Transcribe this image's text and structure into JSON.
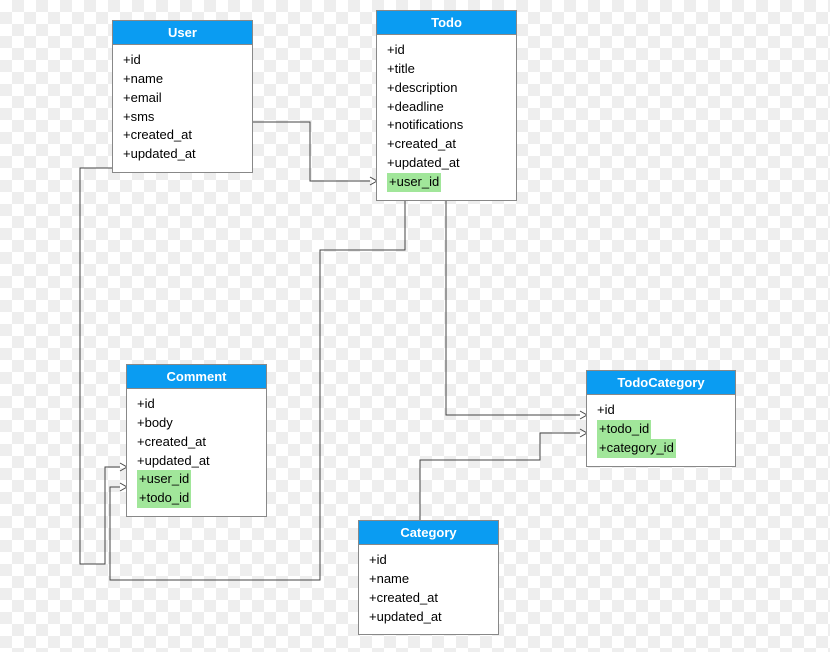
{
  "entities": {
    "user": {
      "title": "User",
      "attrs": [
        "+id",
        "+name",
        "+email",
        "+sms",
        "+created_at",
        "+updated_at"
      ],
      "fks": []
    },
    "todo": {
      "title": "Todo",
      "attrs": [
        "+id",
        "+title",
        "+description",
        "+deadline",
        "+notifications",
        "+created_at",
        "+updated_at"
      ],
      "fks": [
        "+user_id"
      ]
    },
    "comment": {
      "title": "Comment",
      "attrs": [
        "+id",
        "+body",
        "+created_at",
        "+updated_at"
      ],
      "fks": [
        "+user_id",
        "+todo_id"
      ]
    },
    "category": {
      "title": "Category",
      "attrs": [
        "+id",
        "+name",
        "+created_at",
        "+updated_at"
      ]
    },
    "todocategory": {
      "title": "TodoCategory",
      "attrs": [
        "+id"
      ],
      "fks": [
        "+todo_id",
        "+category_id"
      ]
    }
  },
  "relationships": [
    {
      "from": "User.id",
      "to": "Todo.user_id"
    },
    {
      "from": "User.id",
      "to": "Comment.user_id"
    },
    {
      "from": "Todo.id",
      "to": "Comment.todo_id"
    },
    {
      "from": "Todo.id",
      "to": "TodoCategory.todo_id"
    },
    {
      "from": "Category.id",
      "to": "TodoCategory.category_id"
    }
  ]
}
